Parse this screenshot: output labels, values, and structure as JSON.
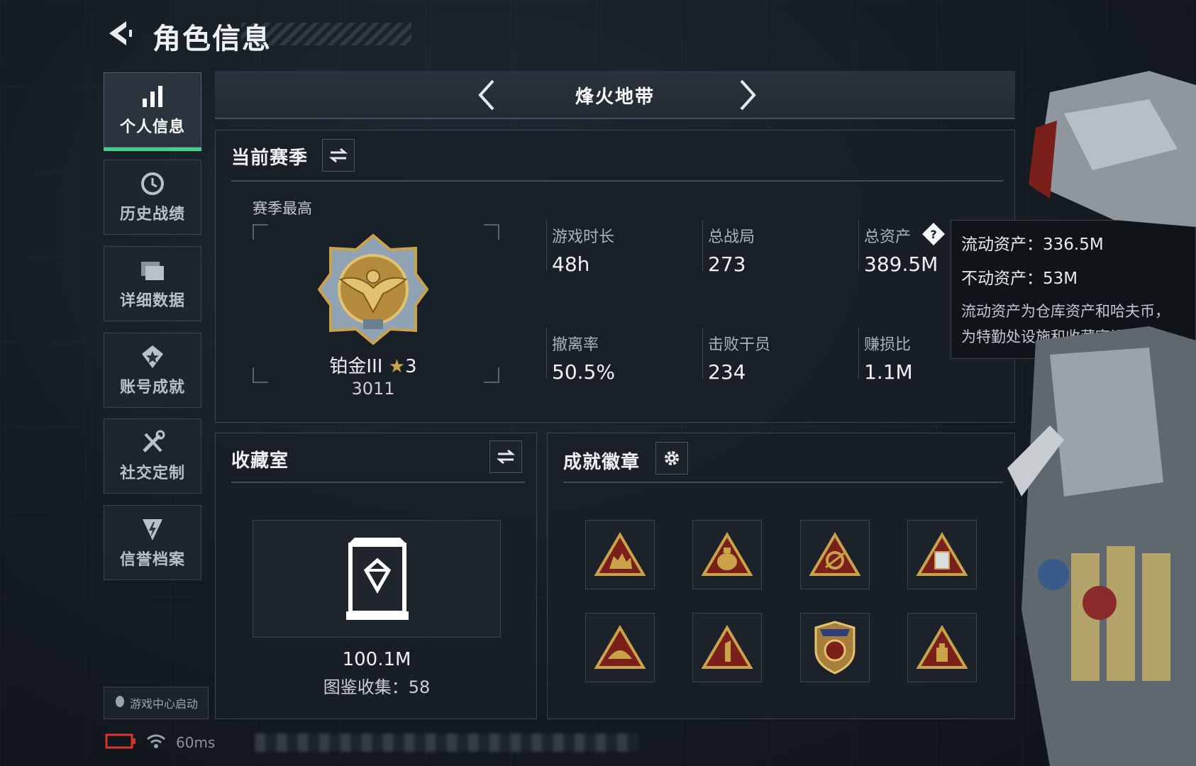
{
  "header": {
    "title": "角色信息"
  },
  "sidebar": {
    "items": [
      {
        "label": "个人信息",
        "icon": "bar-chart-icon",
        "active": true
      },
      {
        "label": "历史战绩",
        "icon": "history-clock-icon",
        "active": false
      },
      {
        "label": "详细数据",
        "icon": "folder-icon",
        "active": false
      },
      {
        "label": "账号成就",
        "icon": "achievement-star-icon",
        "active": false
      },
      {
        "label": "社交定制",
        "icon": "tools-icon",
        "active": false
      },
      {
        "label": "信誉档案",
        "icon": "credit-shield-icon",
        "active": false
      }
    ],
    "qq_launch": "游戏中心启动"
  },
  "mode_selector": {
    "title": "烽火地带"
  },
  "season_panel": {
    "title": "当前赛季",
    "subtitle": "赛季最高",
    "rank": {
      "name": "铂金III",
      "stars": "3",
      "score": "3011"
    },
    "stats": [
      {
        "label": "游戏时长",
        "value": "48h"
      },
      {
        "label": "总战局",
        "value": "273"
      },
      {
        "label": "总资产",
        "value": "389.5M"
      },
      {
        "label": "撤离率",
        "value": "50.5%"
      },
      {
        "label": "击败干员",
        "value": "234"
      },
      {
        "label": "赚损比",
        "value": "1.1M"
      }
    ]
  },
  "tooltip": {
    "liquid": "流动资产：336.5M",
    "fixed": "不动资产：53M",
    "note_line1": "流动资产为仓库资产和哈夫币，",
    "note_line2": "为特勤处设施和收藏室设施"
  },
  "collection_panel": {
    "title": "收藏室",
    "value": "100.1M",
    "catalog": "图鉴收集：58"
  },
  "badges_panel": {
    "title": "成就徽章",
    "badges": [
      "soldiers-badge-icon",
      "money-bag-badge-icon",
      "compass-badge-icon",
      "bucket-badge-icon",
      "shell-badge-icon",
      "number-one-badge-icon",
      "shield-emblem-badge-icon",
      "gold-bar-badge-icon"
    ]
  },
  "status": {
    "ping": "60ms"
  },
  "colors": {
    "accent": "#3fd08a",
    "gold": "#c9a24a",
    "badge_red": "#7a1f1a"
  }
}
